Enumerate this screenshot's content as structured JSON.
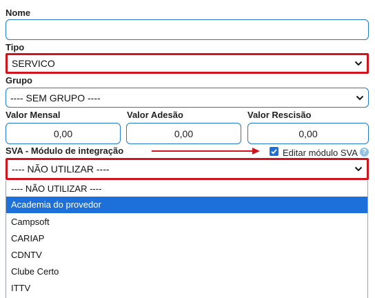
{
  "nome": {
    "label": "Nome",
    "value": ""
  },
  "tipo": {
    "label": "Tipo",
    "value": "SERVICO"
  },
  "grupo": {
    "label": "Grupo",
    "value": "---- SEM GRUPO ----"
  },
  "valores": {
    "mensal": {
      "label": "Valor Mensal",
      "value": "0,00"
    },
    "adesao": {
      "label": "Valor Adesão",
      "value": "0,00"
    },
    "rescisao": {
      "label": "Valor Rescisão",
      "value": "0,00"
    }
  },
  "sva": {
    "label": "SVA - Módulo de integração",
    "value": "---- NÃO UTILIZAR ----",
    "edit_checkbox": {
      "label": "Editar módulo SVA",
      "checked": true
    },
    "help_icon": "?",
    "options": [
      "---- NÃO UTILIZAR ----",
      "Academia do provedor",
      "Campsoft",
      "CARIAP",
      "CDNTV",
      "Clube Certo",
      "ITTV"
    ],
    "highlighted_option": "Academia do provedor"
  },
  "colors": {
    "accent": "#1e78d6",
    "highlight_box": "#d0141e",
    "selected_option": "#1d6fd9",
    "arrow": "#d0141e"
  }
}
